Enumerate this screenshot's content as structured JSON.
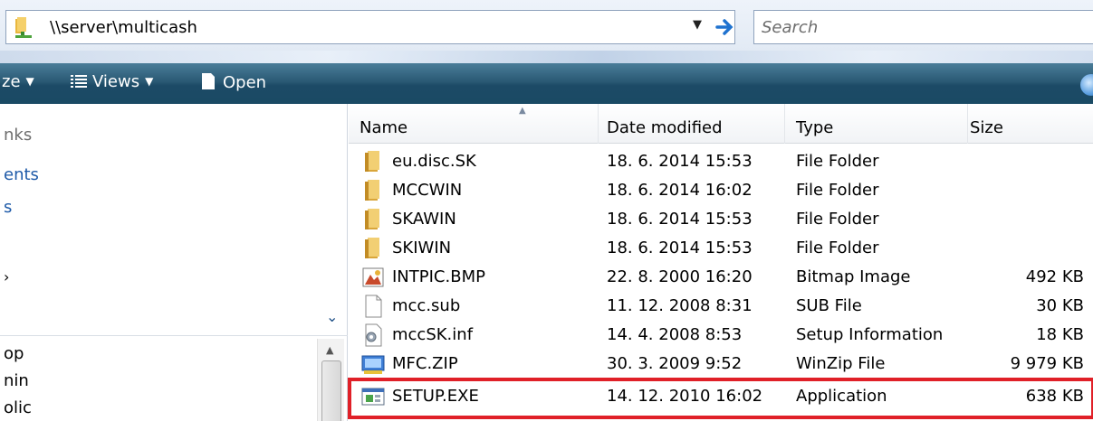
{
  "address": {
    "path": "\\\\server\\multicash",
    "search_placeholder": "Search"
  },
  "toolbar": {
    "organize_label": "ze",
    "views_label": "Views",
    "open_label": "Open"
  },
  "nav": {
    "items": [
      "nks",
      "ents",
      "s",
      "",
      "op",
      "nin",
      "olic"
    ]
  },
  "columns": {
    "name": "Name",
    "date": "Date modified",
    "type": "Type",
    "size": "Size"
  },
  "files": [
    {
      "name": "eu.disc.SK",
      "date": "18. 6. 2014 15:53",
      "type": "File Folder",
      "size": "",
      "icon": "folder-icon"
    },
    {
      "name": "MCCWIN",
      "date": "18. 6. 2014 16:02",
      "type": "File Folder",
      "size": "",
      "icon": "folder-icon"
    },
    {
      "name": "SKAWIN",
      "date": "18. 6. 2014 15:53",
      "type": "File Folder",
      "size": "",
      "icon": "folder-icon"
    },
    {
      "name": "SKIWIN",
      "date": "18. 6. 2014 15:53",
      "type": "File Folder",
      "size": "",
      "icon": "folder-icon"
    },
    {
      "name": "INTPIC.BMP",
      "date": "22. 8. 2000 16:20",
      "type": "Bitmap Image",
      "size": "492 KB",
      "icon": "bitmap-icon"
    },
    {
      "name": "mcc.sub",
      "date": "11. 12. 2008 8:31",
      "type": "SUB File",
      "size": "30 KB",
      "icon": "file-icon"
    },
    {
      "name": "mccSK.inf",
      "date": "14. 4. 2008 8:53",
      "type": "Setup Information",
      "size": "18 KB",
      "icon": "setup-info-icon"
    },
    {
      "name": "MFC.ZIP",
      "date": "30. 3. 2009 9:52",
      "type": "WinZip File",
      "size": "9 979 KB",
      "icon": "zip-icon"
    },
    {
      "name": "SETUP.EXE",
      "date": "14. 12. 2010 16:02",
      "type": "Application",
      "size": "638 KB",
      "icon": "application-icon"
    }
  ],
  "colors": {
    "toolbar": "#2a5974",
    "highlight": "#e02028",
    "link": "#1e5aa8"
  }
}
